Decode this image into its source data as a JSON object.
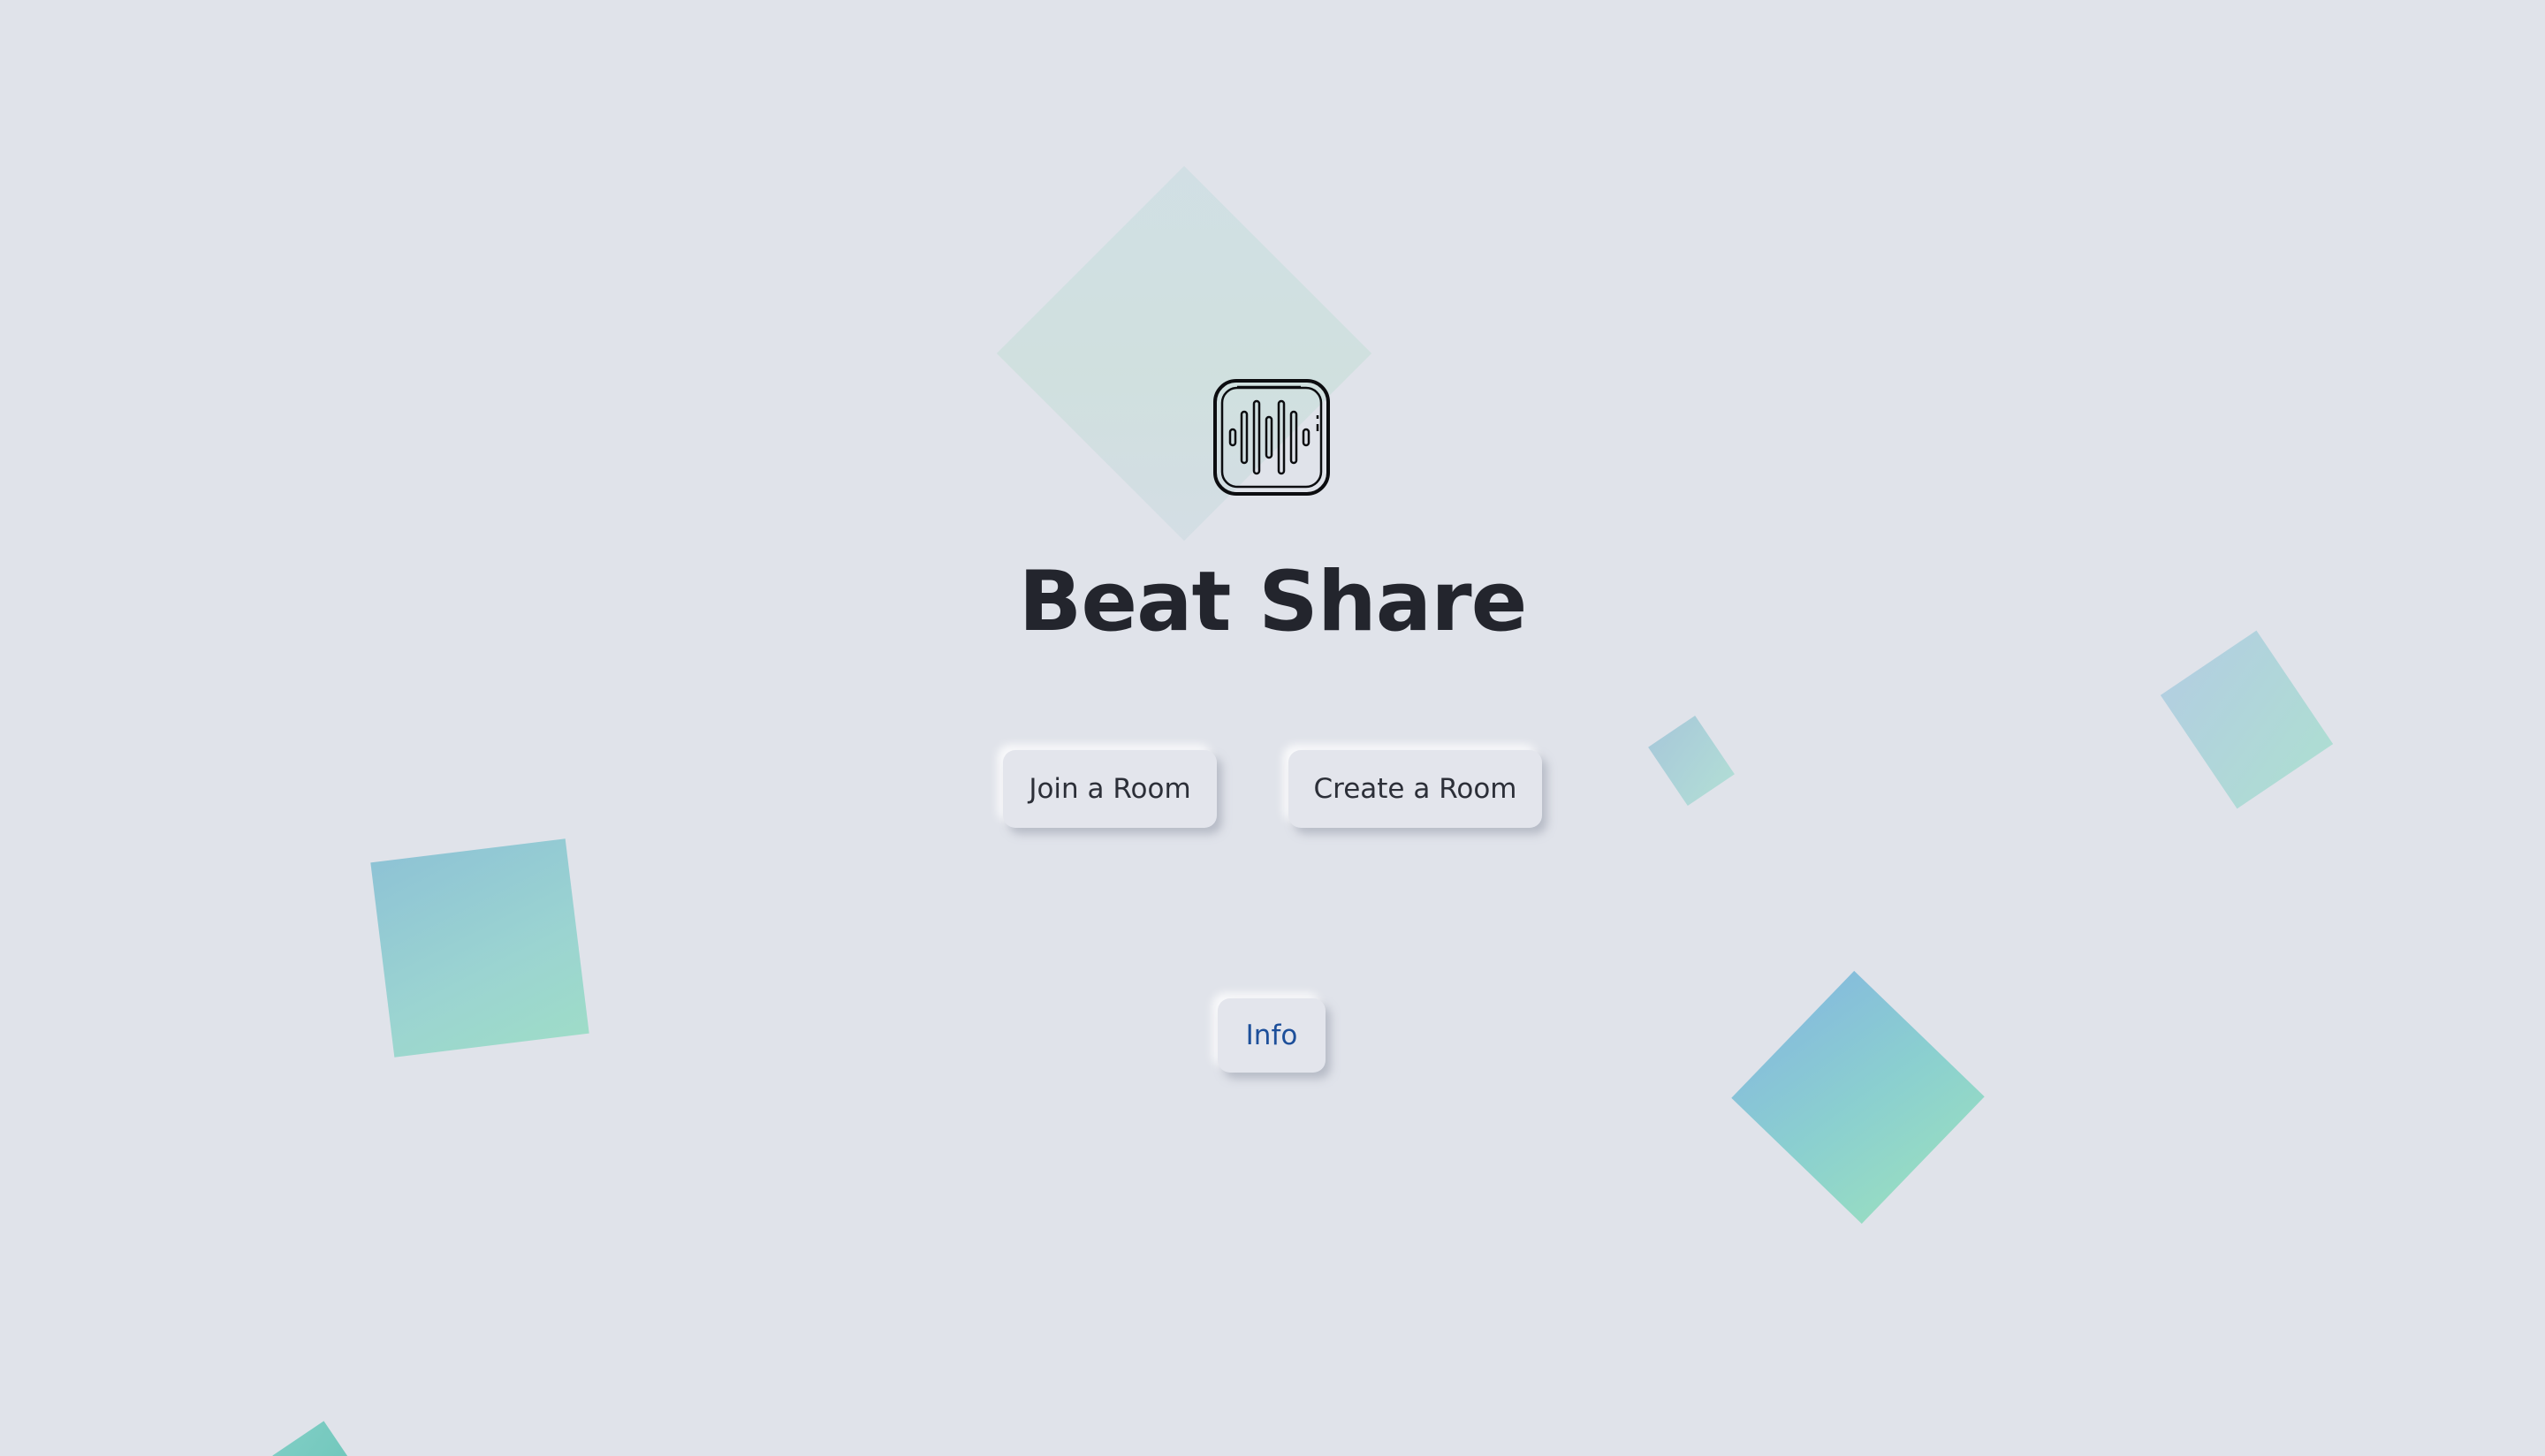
{
  "app": {
    "title": "Beat Share",
    "logo_icon": "audio-waveform-icon"
  },
  "actions": {
    "join_label": "Join a Room",
    "create_label": "Create a Room",
    "info_label": "Info"
  },
  "colors": {
    "background": "#e0e3ea",
    "title_text": "#23252d",
    "info_text": "#1d4f9a",
    "shape_blue": "#8ec3d5",
    "shape_green": "#9edcc8"
  }
}
